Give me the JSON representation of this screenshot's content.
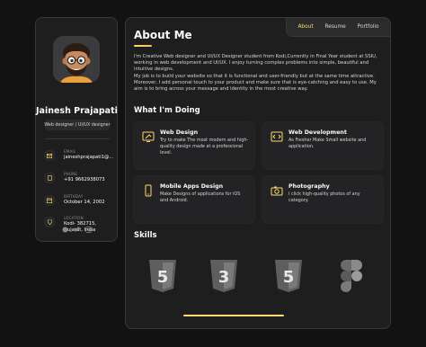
{
  "profile": {
    "name": "Jainesh Prajapati",
    "role": "Web designer / UI/UX designer",
    "contacts": [
      {
        "label": "Email",
        "value": "jaineshprajapati1@...",
        "icon": "mail-icon"
      },
      {
        "label": "Phone",
        "value": "+91 9662938073",
        "icon": "phone-icon"
      },
      {
        "label": "Birthday",
        "value": "October 14, 2002",
        "icon": "calendar-icon"
      },
      {
        "label": "Location",
        "value": "Kodi- 382715, Gujarat, India",
        "icon": "location-icon"
      }
    ],
    "socials": [
      "github-icon",
      "twitter-icon",
      "instagram-icon"
    ]
  },
  "nav": {
    "items": [
      "About",
      "Resume",
      "Portfolio"
    ],
    "active": "About"
  },
  "about": {
    "title": "About Me",
    "paragraphs": [
      "I'm Creative Web designer and UI/UX Designer student from Kodi,Currently in Final Year student at SSIU, working in web development and UI/UX. I enjoy turning complex problems into simple, beautiful and intuitive designs.",
      "My job is to build your website so that it is functional and user-friendly but at the same time attractive. Moreover, I add personal touch to your product and make sure that is eye-catching and easy to use. My aim is to bring across your message and identity in the most creative way."
    ]
  },
  "services": {
    "title": "What I'm Doing",
    "items": [
      {
        "title": "Web Design",
        "text": "Try to make The most modern and high-quality design made at a professional level.",
        "icon": "design-icon"
      },
      {
        "title": "Web Development",
        "text": "As Fresher Make Small website and application.",
        "icon": "code-icon"
      },
      {
        "title": "Mobile Apps Design",
        "text": "Make Designs of applications for iOS and Android.",
        "icon": "mobile-icon"
      },
      {
        "title": "Photography",
        "text": "I click high-quality photos of any category.",
        "icon": "camera-icon"
      }
    ]
  },
  "skills": {
    "title": "Skills",
    "items": [
      {
        "name": "HTML5",
        "glyph": "5",
        "icon": "html5-icon"
      },
      {
        "name": "CSS3",
        "glyph": "3",
        "icon": "css3-icon"
      },
      {
        "name": "HTML5",
        "glyph": "5",
        "icon": "html5-icon"
      },
      {
        "name": "Figma",
        "icon": "figma-icon"
      }
    ],
    "scroll_progress": 1.0
  },
  "colors": {
    "accent": "#ffdb70",
    "card_bg": "#232325",
    "panel_bg": "#1e1e1f",
    "page_bg": "#121212"
  }
}
